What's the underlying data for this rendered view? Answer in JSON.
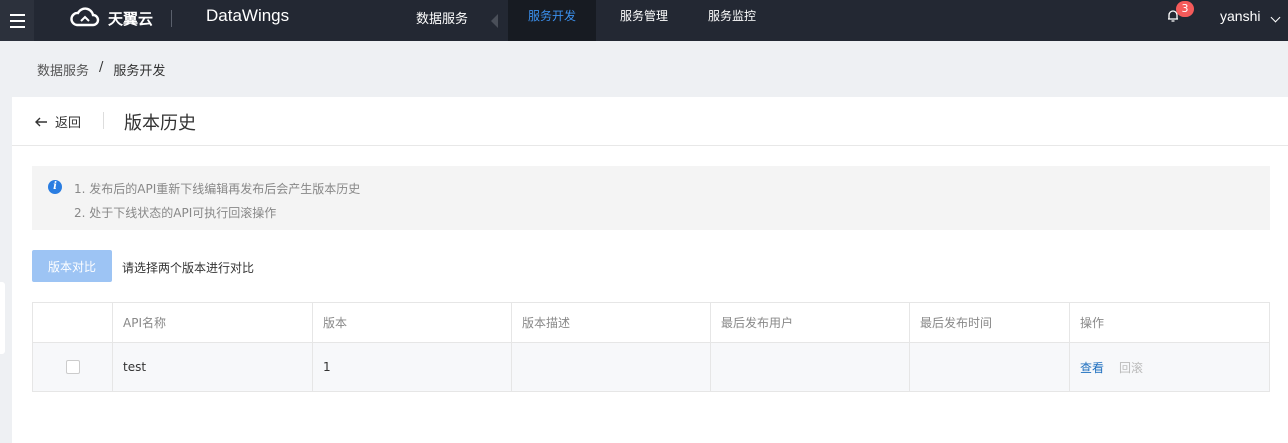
{
  "header": {
    "brand_name": "天翼云",
    "product_name": "DataWings",
    "section": "数据服务",
    "tabs": [
      {
        "label": "服务开发",
        "active": true
      },
      {
        "label": "服务管理",
        "active": false
      },
      {
        "label": "服务监控",
        "active": false
      }
    ],
    "notification_count": "3",
    "username": "yanshi"
  },
  "breadcrumb": {
    "items": [
      "数据服务",
      "服务开发"
    ],
    "separator": "/"
  },
  "page": {
    "back_label": "返回",
    "title": "版本历史",
    "notice": [
      "1. 发布后的API重新下线编辑再发布后会产生版本历史",
      "2. 处于下线状态的API可执行回滚操作"
    ],
    "compare_button": "版本对比",
    "compare_hint": "请选择两个版本进行对比"
  },
  "table": {
    "columns": [
      "API名称",
      "版本",
      "版本描述",
      "最后发布用户",
      "最后发布时间",
      "操作"
    ],
    "rows": [
      {
        "api_name": "test",
        "version": "1",
        "description": "",
        "last_user": "",
        "last_time": "",
        "actions": [
          "查看",
          "回滚"
        ]
      }
    ]
  },
  "colors": {
    "topbar": "#232833",
    "active_tab_text": "#3b90ee",
    "primary_disabled": "#9dc4f4",
    "badge": "#f45a5a",
    "link": "#1f6fbf"
  }
}
